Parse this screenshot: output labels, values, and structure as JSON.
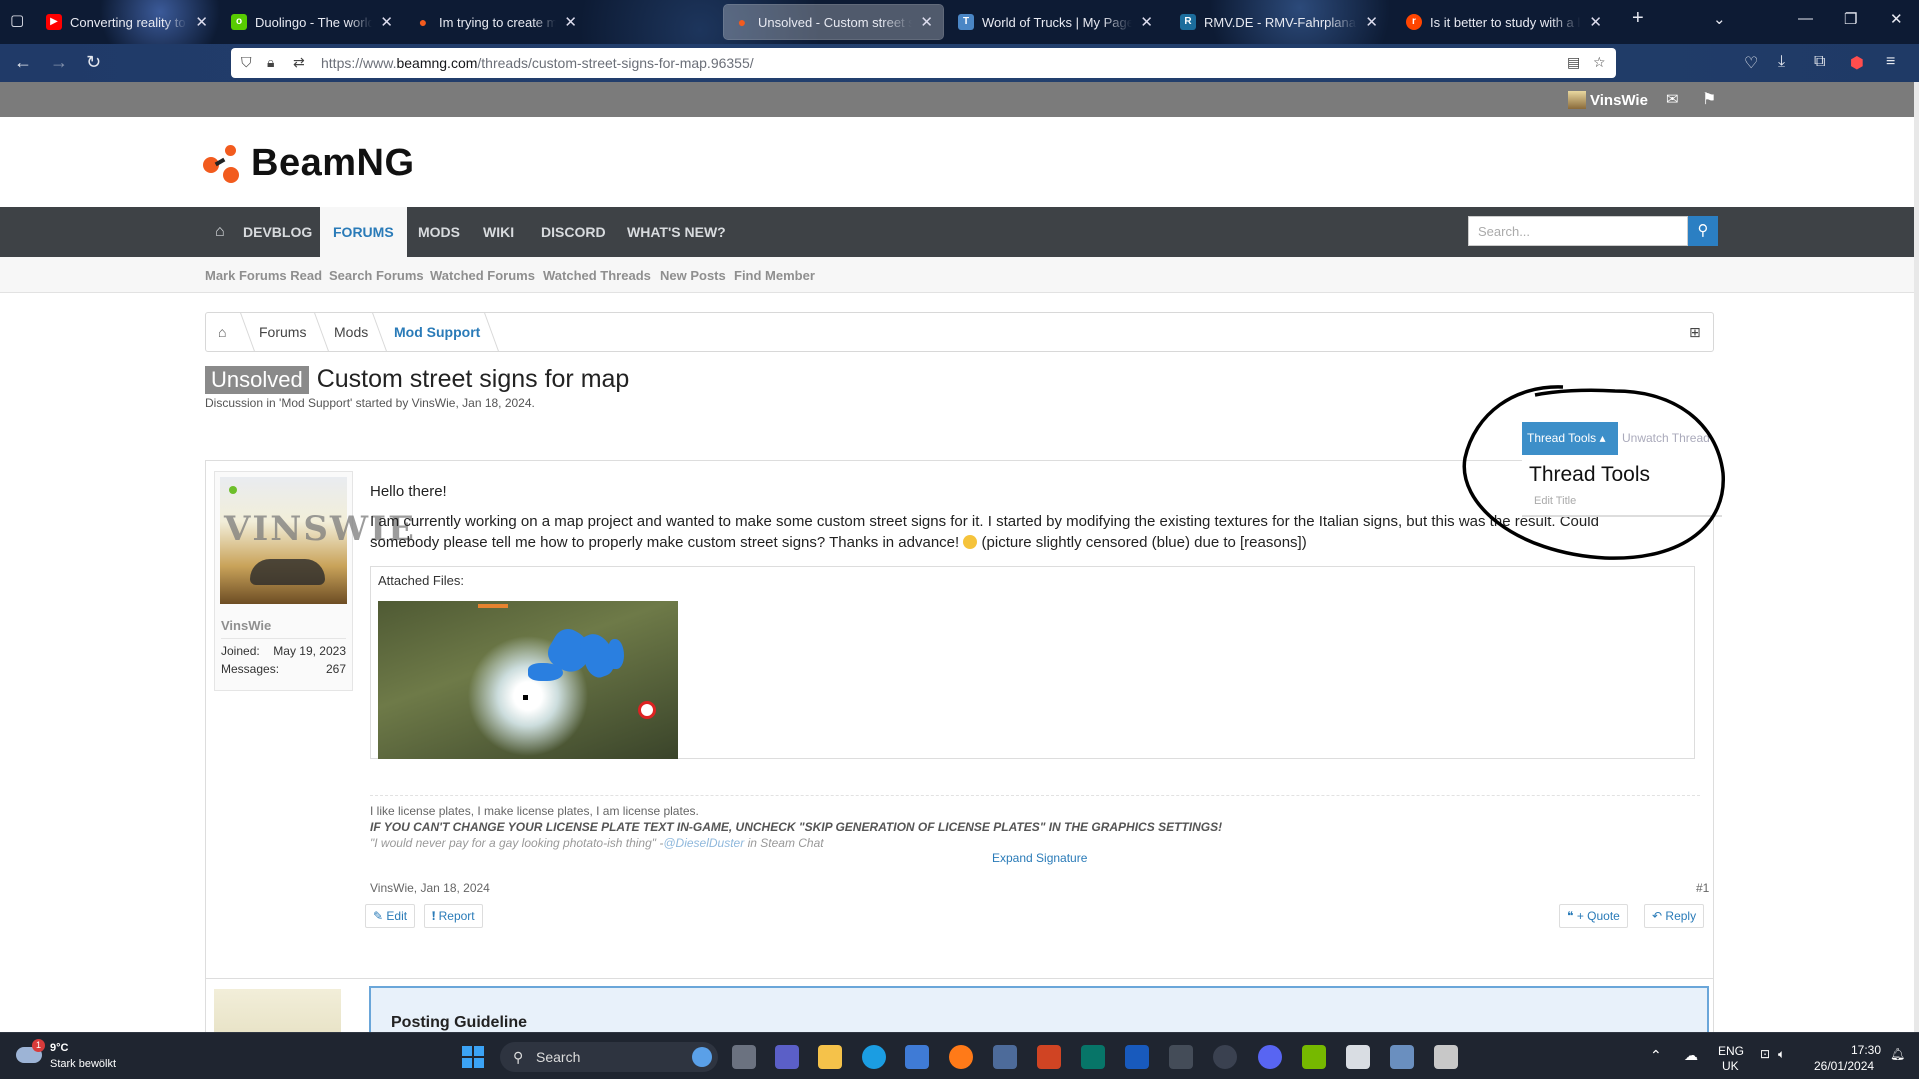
{
  "browser": {
    "tabs": [
      {
        "title": "Converting reality to racing gam",
        "icon": "youtube-icon",
        "color": "#ff0000"
      },
      {
        "title": "Duolingo - The world's best way",
        "icon": "duolingo-icon",
        "color": "#58cc02"
      },
      {
        "title": "Im trying to create my first mod",
        "icon": "beamng-icon",
        "color": "#f25b1e"
      },
      {
        "title": "Unsolved - Custom street signs",
        "icon": "beamng-icon",
        "color": "#f25b1e"
      },
      {
        "title": "World of Trucks | My Page",
        "icon": "truck-icon",
        "color": "#4a86c5"
      },
      {
        "title": "RMV.DE - RMV-Fahrplanauskunft",
        "icon": "rmv-icon",
        "color": "#1c6d9c"
      },
      {
        "title": "Is it better to study with a limit",
        "icon": "reddit-icon",
        "color": "#ff4500"
      }
    ],
    "url_prefix": "https://www.",
    "url_domain": "beamng.com",
    "url_path": "/threads/custom-street-signs-for-map.96355/"
  },
  "site": {
    "username": "VinsWie",
    "logo_text": "BeamNG",
    "nav": [
      "DEVBLOG",
      "FORUMS",
      "MODS",
      "WIKI",
      "DISCORD",
      "WHAT'S NEW?"
    ],
    "nav_active": "FORUMS",
    "search_placeholder": "Search...",
    "subnav": [
      "Mark Forums Read",
      "Search Forums",
      "Watched Forums",
      "Watched Threads",
      "New Posts",
      "Find Member"
    ],
    "breadcrumb": [
      "Forums",
      "Mods",
      "Mod Support"
    ]
  },
  "thread": {
    "badge": "Unsolved",
    "title": "Custom street signs for map",
    "subtitle": "Discussion in 'Mod Support' started by VinsWie, Jan 18, 2024.",
    "tools_label": "Thread Tools",
    "unwatch_label": "Unwatch Thread",
    "menu_heading": "Thread Tools",
    "menu_item": "Edit Title"
  },
  "post": {
    "author": "VinsWie",
    "avatar_text": "VINSWIE",
    "joined_label": "Joined:",
    "joined": "May 19, 2023",
    "messages_label": "Messages:",
    "messages": "267",
    "greeting": "Hello there!",
    "body": "I am currently working on a map project and wanted to make some custom street signs for it. I started by modifying the existing textures for the Italian signs, but this was the result. Could somebody please tell me how to properly make custom street signs? Thanks in advance!",
    "body_tail": "(picture slightly censored (blue) due to [reasons])",
    "attached_label": "Attached Files:",
    "sig_line1": "I like license plates, I make license plates, I am license plates.",
    "sig_line2": "IF YOU CAN'T CHANGE YOUR LICENSE PLATE TEXT IN-GAME, UNCHECK \"SKIP GENERATION OF LICENSE PLATES\" IN THE GRAPHICS SETTINGS!",
    "sig_line3_quote": "\"I would never pay for a gay looking photato-ish thing\" -",
    "sig_line3_link": "@DieselDuster",
    "sig_line3_tail": "in Steam Chat",
    "expand": "Expand Signature",
    "meta": "VinsWie, Jan 18, 2024",
    "number": "#1",
    "edit": "Edit",
    "report": "Report",
    "quote": "+ Quote",
    "reply": "Reply"
  },
  "guideline": {
    "title": "Posting Guideline"
  },
  "taskbar": {
    "weather_temp": "9°C",
    "weather_desc": "Stark bewölkt",
    "weather_badge": "1",
    "search": "Search",
    "lang1": "ENG",
    "lang2": "UK",
    "time": "17:30",
    "date": "26/01/2024"
  },
  "colors": {
    "accent": "#2a7bb8",
    "brand": "#f25b1e",
    "nav_bg": "#3e4246"
  }
}
